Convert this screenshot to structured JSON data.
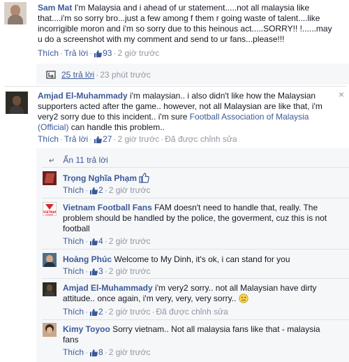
{
  "comments": [
    {
      "author": "Sam Mat",
      "text": "I'm Malaysia and i ahead of ur statement.....not all malaysia like that....i'm so sorry bro...just a few among f them r going waste of talent....like incorrigible moron and i'm so sorry due to this heinous act.....SORRY!! !......may u do a screenshot with my comment and send to ur fans...please!!!",
      "like": "Thích",
      "reply": "Trả lời",
      "likes": "93",
      "time": "2 giờ trước"
    },
    {
      "author": "Amjad El-Muhammady",
      "text_a": "i'm malaysian.. i also didn't like how the Malaysian supporters acted after the game.. however, not all Malaysian are like that, i'm very2 sorry due to this incident.. i'm sure ",
      "text_link": "Football Association of Malaysia (Official)",
      "text_b": " can handle this problem..",
      "like": "Thích",
      "reply": "Trả lời",
      "likes": "27",
      "time": "2 giờ trước",
      "edited": "Đã được chỉnh sửa"
    }
  ],
  "replies_summary": {
    "count": "25 trả lời",
    "time": "23 phút trước"
  },
  "hide_replies": "Ẩn 11 trả lời",
  "replies": [
    {
      "author": "Trọng Nghĩa Phạm",
      "text": "",
      "like": "Thích",
      "likes": "2",
      "time": "2 giờ trước"
    },
    {
      "author": "Vietnam Football Fans",
      "text": "FAM doesn't need to handle that, really. The problem should be handled by the police, the goverment, cuz this is not football",
      "like": "Thích",
      "likes": "4",
      "time": "2 giờ trước"
    },
    {
      "author": "Hoàng Phúc",
      "text": "Welcome to My Dinh, it's ok, i can stand for you",
      "like": "Thích",
      "likes": "3",
      "time": "2 giờ trước"
    },
    {
      "author": "Amjad El-Muhammady",
      "text": "i'm very2 sorry.. not all Malaysian have dirty attitude.. once again, i'm very, very, very sorry..",
      "like": "Thích",
      "likes": "2",
      "time": "2 giờ trước",
      "edited": "Đã được chỉnh sửa"
    },
    {
      "author": "Kimy Toyoo",
      "text": "Sorry vietnam.. Not all malaysia fans like that - malaysia fans",
      "like": "Thích",
      "likes": "8",
      "time": "2 giờ trước"
    }
  ],
  "avatar_logo_text": "VIETNAM FANS",
  "colors": {
    "link": "#3b5998",
    "meta": "#9197a3",
    "panel": "#f6f7f9"
  }
}
